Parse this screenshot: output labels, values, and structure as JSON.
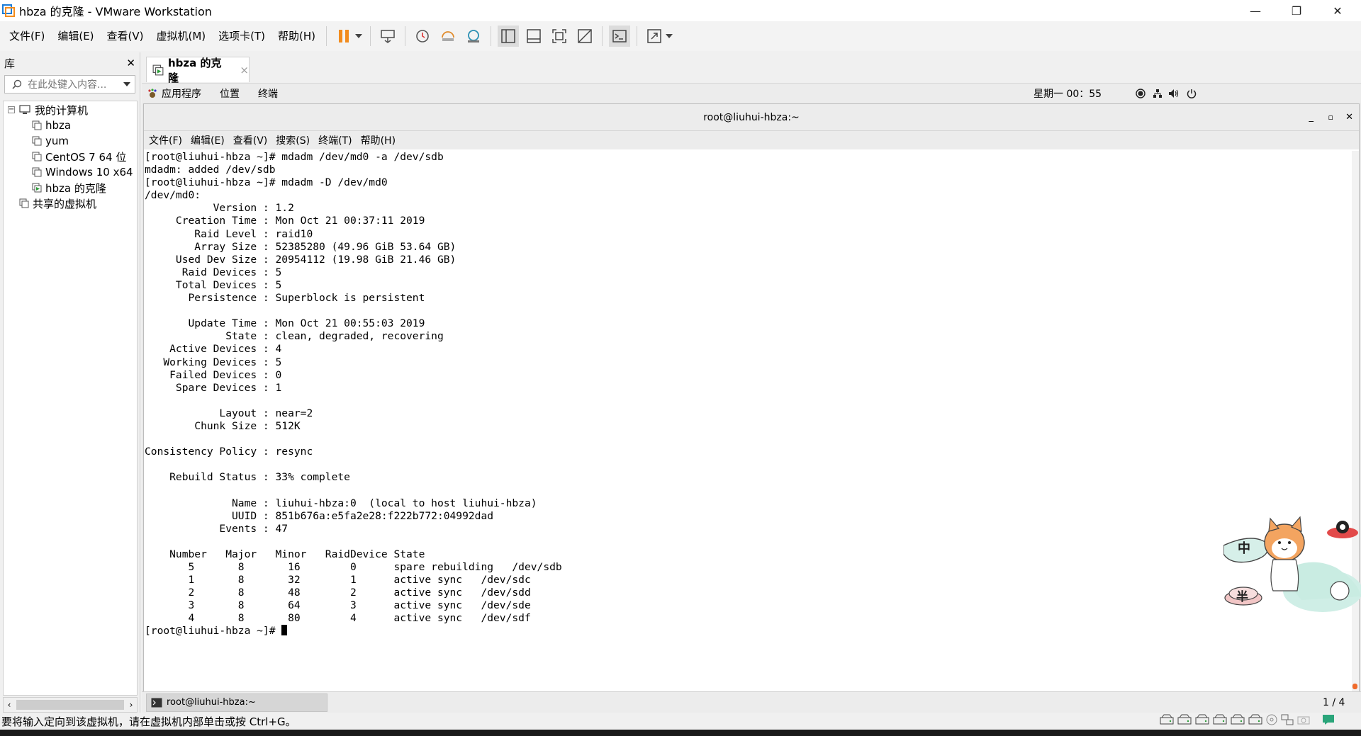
{
  "window": {
    "title": "hbza 的克隆 - VMware Workstation",
    "minimize_glyph": "—",
    "restore_glyph": "❐",
    "close_glyph": "✕"
  },
  "menu": [
    "文件(F)",
    "编辑(E)",
    "查看(V)",
    "虚拟机(M)",
    "选项卡(T)",
    "帮助(H)"
  ],
  "library": {
    "title": "库",
    "close_glyph": "✕",
    "search_placeholder": "在此处键入内容...",
    "tree": {
      "root": "我的计算机",
      "vms": [
        "hbza",
        "yum",
        "CentOS 7 64 位",
        "Windows 10 x64",
        "hbza 的克隆"
      ],
      "shared": "共享的虚拟机"
    }
  },
  "vm_tab": {
    "label": "hbza 的克隆",
    "close_glyph": "×"
  },
  "gnome": {
    "menus": [
      "应用程序",
      "位置",
      "终端"
    ],
    "clock": "星期一 00：55"
  },
  "terminal": {
    "title": "root@liuhui-hbza:~",
    "menu": [
      "文件(F)",
      "编辑(E)",
      "查看(V)",
      "搜索(S)",
      "终端(T)",
      "帮助(H)"
    ],
    "lines": [
      "[root@liuhui-hbza ~]# mdadm /dev/md0 -a /dev/sdb",
      "mdadm: added /dev/sdb",
      "[root@liuhui-hbza ~]# mdadm -D /dev/md0",
      "/dev/md0:",
      "           Version : 1.2",
      "     Creation Time : Mon Oct 21 00:37:11 2019",
      "        Raid Level : raid10",
      "        Array Size : 52385280 (49.96 GiB 53.64 GB)",
      "     Used Dev Size : 20954112 (19.98 GiB 21.46 GB)",
      "      Raid Devices : 5",
      "     Total Devices : 5",
      "       Persistence : Superblock is persistent",
      "",
      "       Update Time : Mon Oct 21 00:55:03 2019",
      "             State : clean, degraded, recovering",
      "    Active Devices : 4",
      "   Working Devices : 5",
      "    Failed Devices : 0",
      "     Spare Devices : 1",
      "",
      "            Layout : near=2",
      "        Chunk Size : 512K",
      "",
      "Consistency Policy : resync",
      "",
      "    Rebuild Status : 33% complete",
      "",
      "              Name : liuhui-hbza:0  (local to host liuhui-hbza)",
      "              UUID : 851b676a:e5fa2e28:f222b772:04992dad",
      "            Events : 47",
      "",
      "    Number   Major   Minor   RaidDevice State",
      "       5       8       16        0      spare rebuilding   /dev/sdb",
      "       1       8       32        1      active sync   /dev/sdc",
      "       2       8       48        2      active sync   /dev/sdd",
      "       3       8       64        3      active sync   /dev/sde",
      "       4       8       80        4      active sync   /dev/sdf"
    ],
    "prompt": "[root@liuhui-hbza ~]# "
  },
  "taskbar": {
    "item": "root@liuhui-hbza:~",
    "workspace": "1 / 4"
  },
  "status": {
    "hint": "要将输入定向到该虚拟机，请在虚拟机内部单击或按 Ctrl+G。"
  },
  "mascot": {
    "ime_mode": "中",
    "half_width": "半"
  },
  "colors": {
    "pause_accent": "#f28c1e",
    "terminal_bg": "#ffffff",
    "window_bg": "#f0f0f0"
  }
}
